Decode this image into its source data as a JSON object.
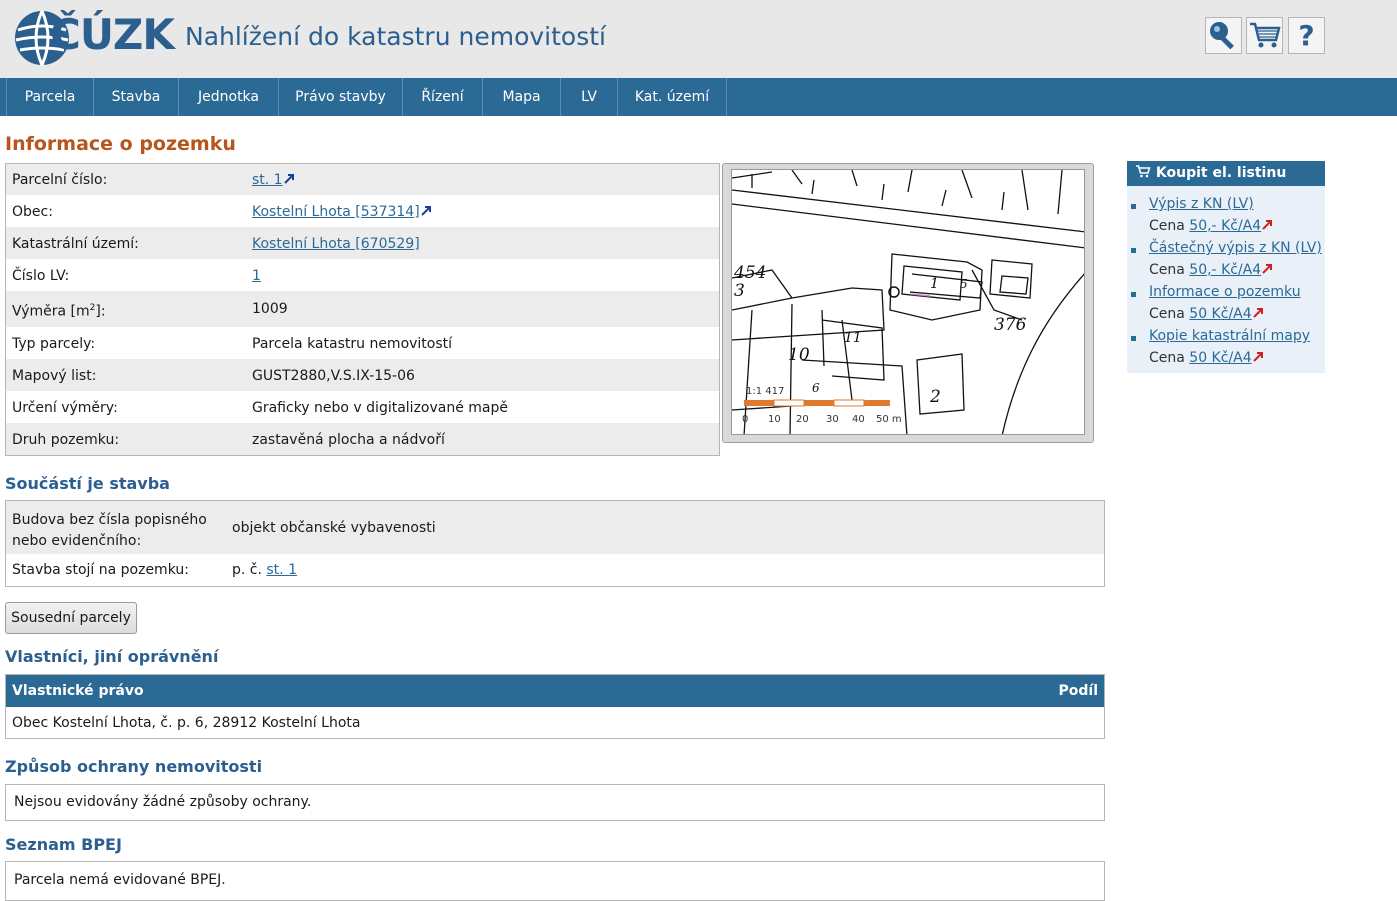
{
  "header": {
    "logo_text": "ČÚZK",
    "title": "Nahlížení do katastru nemovitostí",
    "buttons": [
      {
        "icon": "key-icon"
      },
      {
        "icon": "cart-icon"
      },
      {
        "icon": "help-icon",
        "label": "?"
      }
    ]
  },
  "nav": {
    "items": [
      "Parcela",
      "Stavba",
      "Jednotka",
      "Právo stavby",
      "Řízení",
      "Mapa",
      "LV",
      "Kat. území"
    ]
  },
  "info": {
    "heading": "Informace o pozemku",
    "rows": [
      {
        "label": "Parcelní číslo:",
        "value": "st. 1"
      },
      {
        "label": "Obec:",
        "value": "Kostelní Lhota [537314]"
      },
      {
        "label": "Katastrální území:",
        "value": "Kostelní Lhota [670529]"
      },
      {
        "label": "Číslo LV:",
        "value": "1"
      },
      {
        "label": "Výměra [m",
        "label_sup": "2",
        "label_end": "]:",
        "value": "1009"
      },
      {
        "label": "Typ parcely:",
        "value": "Parcela katastru nemovitostí"
      },
      {
        "label": "Mapový list:",
        "value": "GUST2880,V.S.IX-15-06"
      },
      {
        "label": "Určení výměry:",
        "value": "Graficky nebo v digitalizované mapě"
      },
      {
        "label": "Druh pozemku:",
        "value": "zastavěná plocha a nádvoří"
      }
    ]
  },
  "map": {
    "scale": "1:1 417",
    "scale_ticks": [
      "0",
      "10",
      "20",
      "30",
      "40",
      "50 m"
    ],
    "labels": [
      "454",
      "3",
      "376",
      "2",
      "1",
      "5",
      "11",
      "10",
      "6"
    ]
  },
  "sidebar": {
    "title": "Koupit el. listinu",
    "items": [
      {
        "label": "Výpis z KN (LV)",
        "price_prefix": "Cena ",
        "price": "50,- Kč/A4"
      },
      {
        "label": "Částečný výpis z KN (LV)",
        "price_prefix": "Cena ",
        "price": "50,- Kč/A4"
      },
      {
        "label": "Informace o pozemku",
        "price_prefix": "Cena ",
        "price": "50 Kč/A4"
      },
      {
        "label": "Kopie katastrální mapy",
        "price_prefix": "Cena ",
        "price": "50 Kč/A4"
      }
    ]
  },
  "building": {
    "heading": "Součástí je stavba",
    "row1_label_line1": "Budova bez čísla popisného",
    "row1_label_line2": "nebo evidenčního:",
    "row1_value": "objekt občanské vybavenosti",
    "row2_label": "Stavba stojí na pozemku:",
    "row2_value_prefix": "p. č. ",
    "row2_value_link": "st. 1"
  },
  "neighbors_button": "Sousední parcely",
  "owners": {
    "heading": "Vlastníci, jiní oprávnění",
    "col_owner": "Vlastnické právo",
    "col_share": "Podíl",
    "rows": [
      {
        "name": "Obec Kostelní Lhota, č. p. 6, 28912 Kostelní Lhota",
        "share": ""
      }
    ]
  },
  "protection": {
    "heading": "Způsob ochrany nemovitosti",
    "text": "Nejsou evidovány žádné způsoby ochrany."
  },
  "bpej": {
    "heading": "Seznam BPEJ",
    "text": "Parcela nemá evidované BPEJ."
  },
  "colors": {
    "brand_blue": "#2c6a96",
    "heading_orange": "#b5561d",
    "external_link_red": "#cc2222"
  }
}
